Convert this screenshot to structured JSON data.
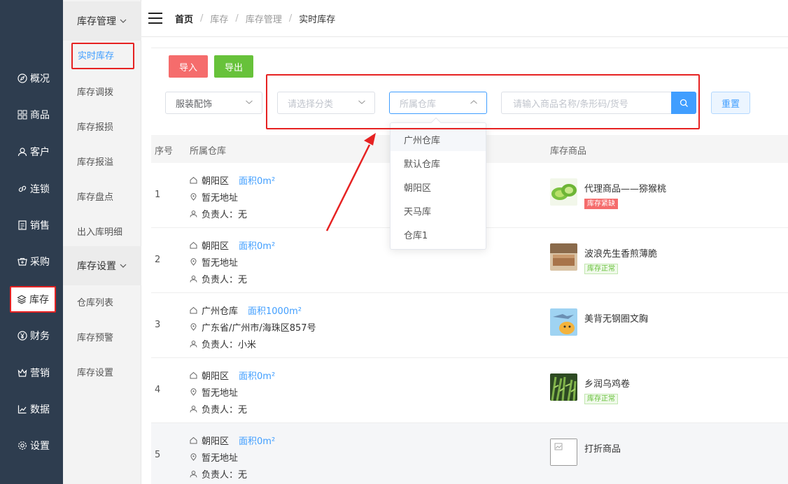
{
  "rail": {
    "items": [
      {
        "label": "概况",
        "icon": "compass-icon"
      },
      {
        "label": "商品",
        "icon": "grid-icon"
      },
      {
        "label": "客户",
        "icon": "user-icon"
      },
      {
        "label": "连锁",
        "icon": "link-icon"
      },
      {
        "label": "销售",
        "icon": "document-icon"
      },
      {
        "label": "采购",
        "icon": "purchase-icon"
      },
      {
        "label": "库存",
        "icon": "layers-icon"
      },
      {
        "label": "财务",
        "icon": "yen-icon"
      },
      {
        "label": "营销",
        "icon": "crown-icon"
      },
      {
        "label": "数据",
        "icon": "chart-icon"
      },
      {
        "label": "设置",
        "icon": "gear-icon"
      }
    ]
  },
  "submenu": {
    "group1": "库存管理",
    "items1": [
      "实时库存",
      "库存调拨",
      "库存报损",
      "库存报溢",
      "库存盘点",
      "出入库明细"
    ],
    "group2": "库存设置",
    "items2": [
      "仓库列表",
      "库存预警",
      "库存设置"
    ]
  },
  "breadcrumb": {
    "home": "首页",
    "sep": "/",
    "l1": "库存",
    "l2": "库存管理",
    "current": "实时库存"
  },
  "toolbar": {
    "import_label": "导入",
    "export_label": "导出",
    "import_color": "#f56c6c",
    "export_color": "#67c23a"
  },
  "filters": {
    "category_value": "服装配饰",
    "subcategory_placeholder": "请选择分类",
    "warehouse_placeholder": "所属仓库",
    "search_placeholder": "请输入商品名称/条形码/货号",
    "reset_label": "重置"
  },
  "dropdown": {
    "options": [
      "广州仓库",
      "默认仓库",
      "朝阳区",
      "天马库",
      "仓库1"
    ]
  },
  "table": {
    "headers": {
      "index": "序号",
      "warehouse": "所属仓库",
      "goods": "库存商品"
    },
    "owner_prefix": "负责人：",
    "rows": [
      {
        "index": "1",
        "warehouse": "朝阳区",
        "area": "面积0m²",
        "address": "暂无地址",
        "owner": "无",
        "product": "代理商品——猕猴桃",
        "tag": "库存紧缺",
        "tag_type": "warn",
        "thumb": "kiwi"
      },
      {
        "index": "2",
        "warehouse": "朝阳区",
        "area": "面积0m²",
        "address": "暂无地址",
        "owner": "无",
        "product": "波浪先生香煎薄脆",
        "tag": "库存正常",
        "tag_type": "ok",
        "thumb": "bed"
      },
      {
        "index": "3",
        "warehouse": "广州仓库",
        "area": "面积1000m²",
        "address": "广东省/广州市/海珠区857号",
        "owner": "小米",
        "product": "美背无钢圈文胸",
        "tag": "",
        "tag_type": "",
        "thumb": "cartoon"
      },
      {
        "index": "4",
        "warehouse": "朝阳区",
        "area": "面积0m²",
        "address": "暂无地址",
        "owner": "无",
        "product": "乡润乌鸡卷",
        "tag": "库存正常",
        "tag_type": "ok",
        "thumb": "plant"
      },
      {
        "index": "5",
        "warehouse": "朝阳区",
        "area": "面积0m²",
        "address": "暂无地址",
        "owner": "无",
        "product": "打折商品",
        "tag": "",
        "tag_type": "",
        "thumb": "placeholder"
      }
    ]
  }
}
